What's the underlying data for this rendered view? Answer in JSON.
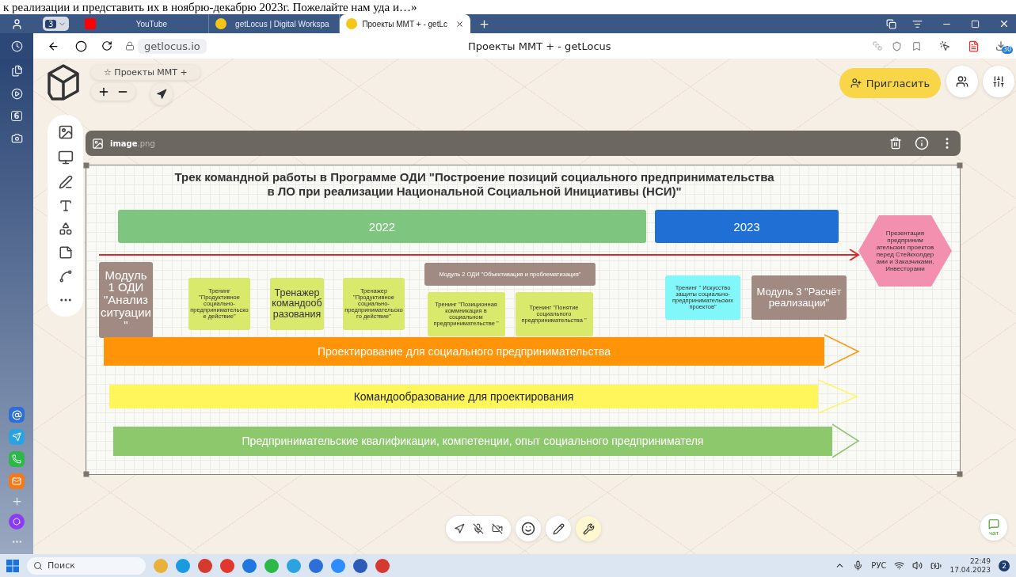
{
  "caption": "к реализации и представить их в ноябрю-декабрю 2023г. Пожелайте нам уда и…»",
  "browser": {
    "tab_count": "3",
    "tabs": [
      {
        "title": "YouTube",
        "kind": "video",
        "selected": false
      },
      {
        "title": "getLocus | Digital Workspa",
        "kind": "site",
        "selected": false
      },
      {
        "title": "Проекты ММТ + - getLc",
        "kind": "site",
        "selected": true
      }
    ],
    "url": "getlocus.io",
    "page_title": "Проекты ММТ + - getLocus",
    "download_badge": "30",
    "sidebar_counter": "6"
  },
  "board": {
    "name": "☆ Проекты ММТ +",
    "invite": "Пригласить",
    "file": {
      "name": "image",
      "ext": ".png"
    },
    "chat": "чат"
  },
  "diagram": {
    "title": "Трек командной работы в Программе ОДИ \"Построение позиций социального предпринимательства в ЛО при реализации Национальной Социальной Инициативы (НСИ)\"",
    "years": [
      {
        "label": "2022",
        "color": "#7ec67f"
      },
      {
        "label": "2023",
        "color": "#1f6fd4"
      }
    ],
    "goal": "Презентация предприним ательских проектов перед Стейкхолдер ами и Заказчиками, Инвесторами",
    "blocks": [
      {
        "kind": "module",
        "color": "#a08a82",
        "text": "Модуль 1 ОДИ \"Анализ ситуации\""
      },
      {
        "kind": "training",
        "color": "#d8e96c",
        "text": "Тренинг \"Продуктивное социально-предпринимательское действие\""
      },
      {
        "kind": "trainer",
        "color": "#d8e96c",
        "text": "Тренажер командообразования"
      },
      {
        "kind": "training",
        "color": "#d8e96c",
        "text": "Тренажер \"Продуктивное социально-предпринимательского действие\""
      },
      {
        "kind": "group",
        "color": "#a08a82",
        "text": "Модуль 2 ОДИ \"Объективация и проблематизация\"",
        "children": [
          {
            "kind": "training",
            "color": "#d8e96c",
            "text": "Тренинг \"Позиционная коммникация в социальном предпринимательстве \""
          },
          {
            "kind": "training",
            "color": "#d8e96c",
            "text": "Тренинг \"Понятие социального предпринимательства \""
          }
        ]
      },
      {
        "kind": "training",
        "color": "#82f7fa",
        "text": "Тренинг  \" Искусство защиты социально-предпринимательских проектов\""
      },
      {
        "kind": "module3",
        "color": "#a08a82",
        "text": "Модуль 3  \"Расчёт реализации\""
      }
    ],
    "tracks": [
      {
        "text": "Проектирование для социального предпринимательства",
        "color": "#ff9408"
      },
      {
        "text": "Командообразование для проектирования",
        "color": "#fff65c"
      },
      {
        "text": "Предпринимательские квалификации, компетенции, опыт социального предпринимателя",
        "color": "#8dc86d"
      }
    ]
  },
  "taskbar": {
    "search": "Поиск",
    "lang": "РУС",
    "time": "22:49",
    "date": "17.04.2023",
    "notifications": "2"
  }
}
